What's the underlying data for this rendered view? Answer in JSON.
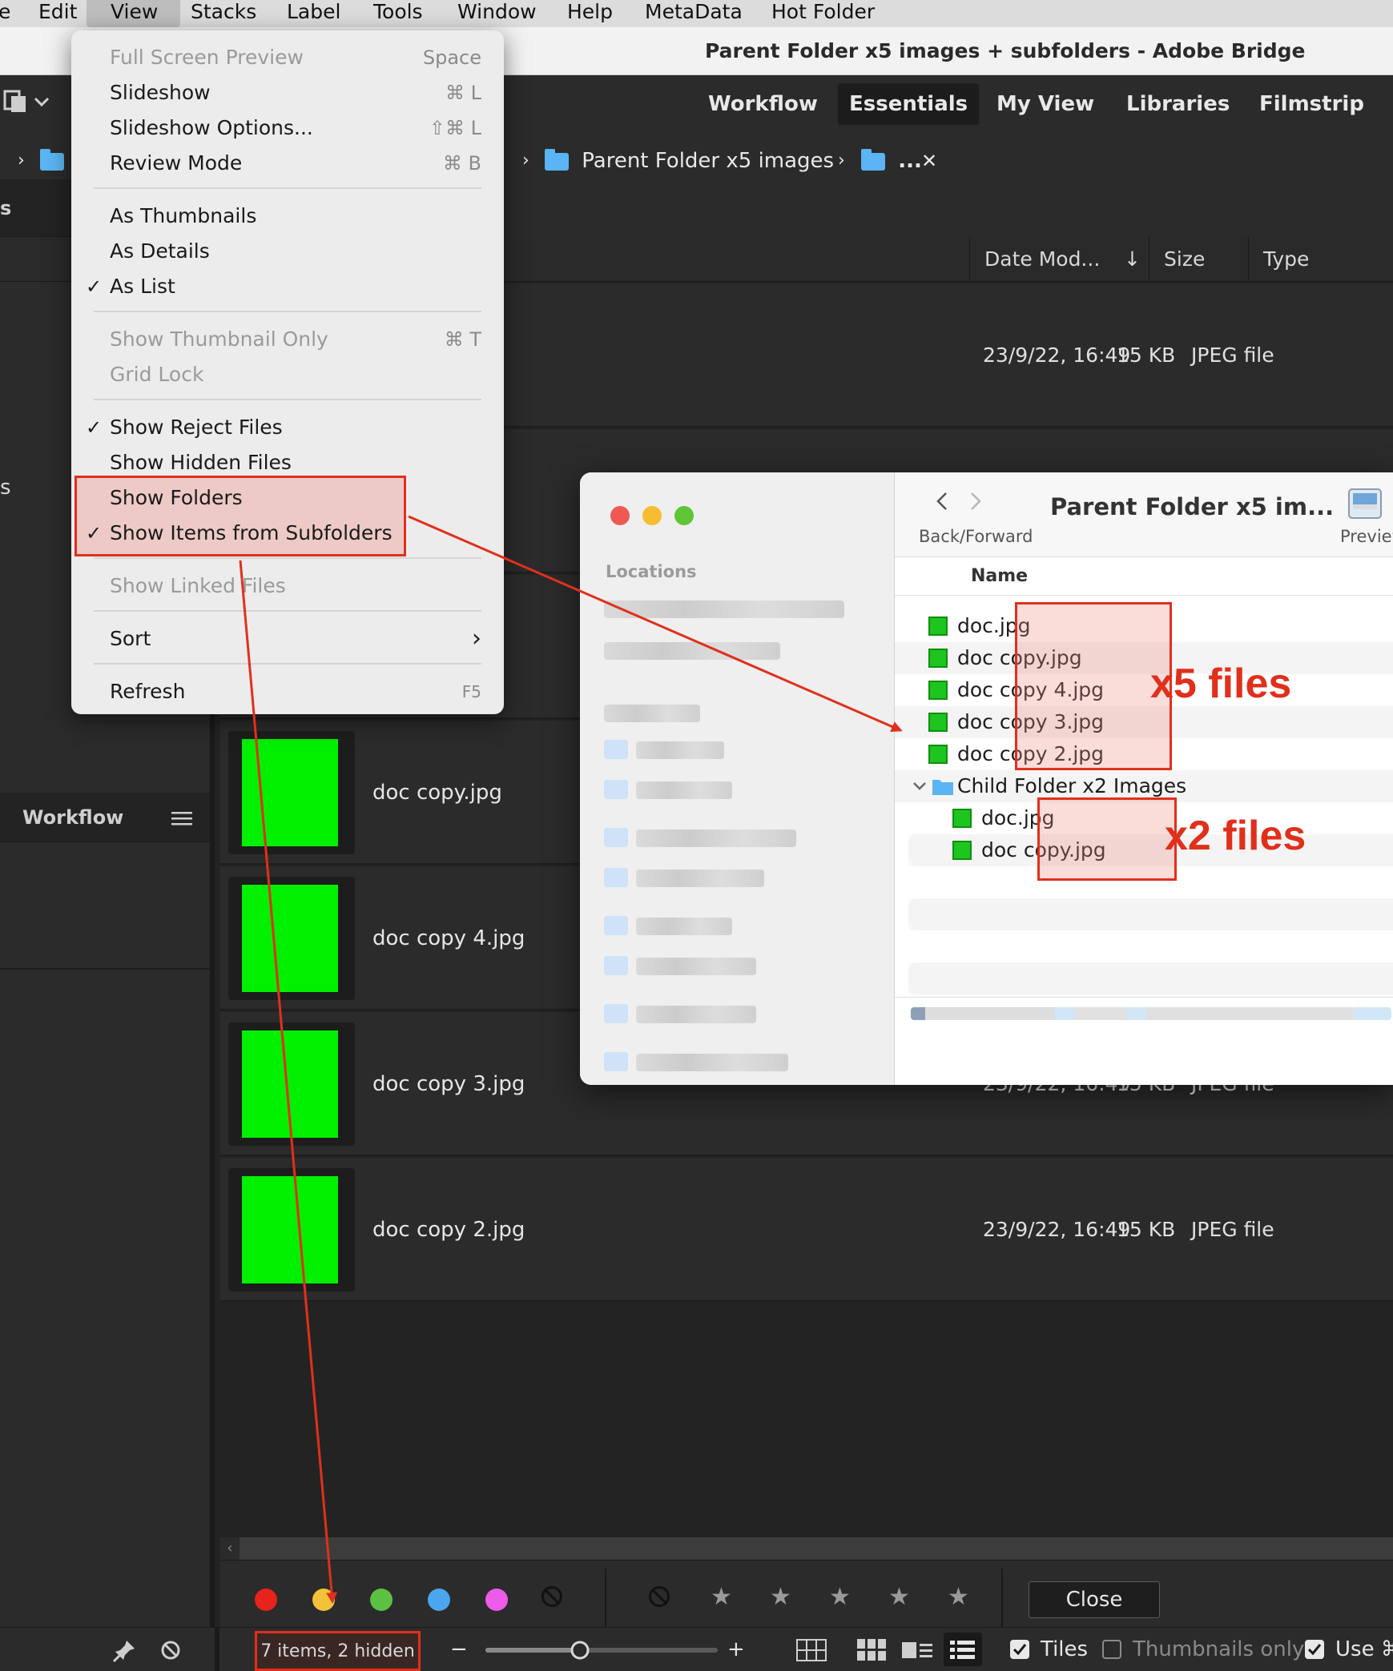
{
  "menubar": {
    "items": [
      "e",
      "Edit",
      "View",
      "Stacks",
      "Label",
      "Tools",
      "Window",
      "Help",
      "MetaData",
      "Hot Folder"
    ],
    "active": "View"
  },
  "window": {
    "title": "Parent Folder x5 images + subfolders - Adobe Bridge"
  },
  "workspaces": [
    "Workflow",
    "Essentials",
    "My View",
    "Libraries",
    "Filmstrip"
  ],
  "workspace_active": "Essentials",
  "path": {
    "current": "Parent Folder x5 images",
    "ellipsis": "...",
    "close": "✕"
  },
  "left_panel": {
    "tab_top": "s",
    "side_text": "s",
    "workflow_tab": "Workflow"
  },
  "columns": {
    "date": "Date Mod...",
    "sort_arrow": "↓",
    "size": "Size",
    "type": "Type"
  },
  "files": [
    {
      "name": "",
      "date": "23/9/22, 16:49",
      "size": "15 KB",
      "type": "JPEG file"
    },
    {
      "name": "doc copy.jpg",
      "date": "",
      "size": "",
      "type": ""
    },
    {
      "name": "doc copy 4.jpg",
      "date": "",
      "size": "",
      "type": ""
    },
    {
      "name": "doc copy 3.jpg",
      "date": "23/9/22, 16:49",
      "size": "15 KB",
      "type": "JPEG file"
    },
    {
      "name": "doc copy 2.jpg",
      "date": "23/9/22, 16:49",
      "size": "15 KB",
      "type": "JPEG file"
    }
  ],
  "view_menu": {
    "items": [
      {
        "label": "Full Screen Preview",
        "shortcut": "Space",
        "disabled": true
      },
      {
        "label": "Slideshow",
        "shortcut": "⌘ L"
      },
      {
        "label": "Slideshow Options...",
        "shortcut": "⇧⌘ L"
      },
      {
        "label": "Review Mode",
        "shortcut": "⌘ B"
      },
      {
        "label": "As Thumbnails"
      },
      {
        "label": "As Details"
      },
      {
        "label": "As List",
        "checked": true
      },
      {
        "label": "Show Thumbnail Only",
        "shortcut": "⌘ T",
        "disabled": true
      },
      {
        "label": "Grid Lock",
        "disabled": true
      },
      {
        "label": "Show Reject Files",
        "checked": true
      },
      {
        "label": "Show Hidden Files"
      },
      {
        "label": "Show Folders"
      },
      {
        "label": "Show Items from Subfolders",
        "checked": true
      },
      {
        "label": "Show Linked Files",
        "disabled": true
      },
      {
        "label": "Sort",
        "submenu": "›"
      },
      {
        "label": "Refresh",
        "shortcut": "F5"
      }
    ],
    "checkmark": "✓"
  },
  "finder": {
    "title": "Parent Folder x5 im...",
    "back_forward": "Back/Forward",
    "preview_label": "Preview.a",
    "locations": "Locations",
    "name_column": "Name",
    "parent_files": [
      "doc.jpg",
      "doc copy.jpg",
      "doc copy 4.jpg",
      "doc copy 3.jpg",
      "doc copy 2.jpg"
    ],
    "child_folder": "Child Folder x2 Images",
    "child_files": [
      "doc.jpg",
      "doc copy.jpg"
    ],
    "annot_x5": "x5 files",
    "annot_x2": "x2 files"
  },
  "filter": {
    "close": "Close",
    "label_colors": [
      "#e8221c",
      "#f2c23a",
      "#5cc142",
      "#4aa6ef",
      "#ec5ce8"
    ]
  },
  "status": {
    "items": "7 items, 2 hidden",
    "minus": "−",
    "plus": "+",
    "tiles": "Tiles",
    "thumbs_only": "Thumbnails only",
    "use": "Use ⌘"
  },
  "colors": {
    "accent_red": "#e0301c",
    "thumb_green": "#00f000"
  }
}
